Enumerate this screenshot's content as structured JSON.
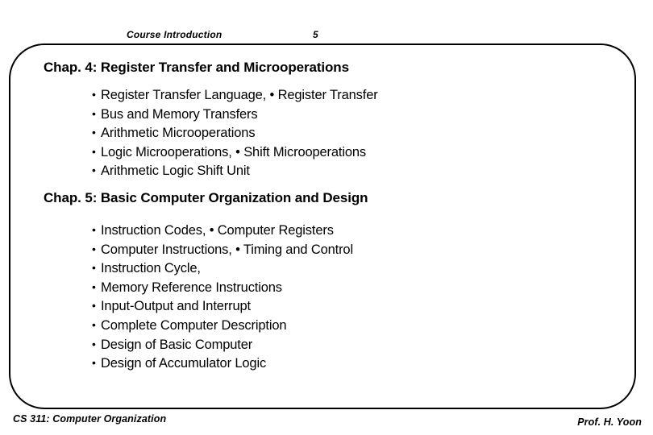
{
  "header": {
    "title": "Course  Introduction",
    "slide_number": "5"
  },
  "frame": {
    "border_color": "#000000",
    "background_color": "#FFFFFF"
  },
  "body": {
    "sections": [
      {
        "heading": "Chap. 4: Register Transfer and Microoperations",
        "bullet_glyph": "•",
        "items": [
          "Register Transfer Language, • Register Transfer",
          "Bus and Memory Transfers",
          "Arithmetic Microoperations",
          "Logic Microoperations, • Shift Microoperations",
          "Arithmetic Logic Shift Unit"
        ]
      },
      {
        "heading": "Chap. 5: Basic Computer Organization and Design",
        "bullet_glyph": "•",
        "items": [
          "Instruction Codes, • Computer Registers",
          "Computer Instructions, • Timing and Control",
          "Instruction Cycle,",
          "Memory Reference Instructions",
          "Input-Output and Interrupt",
          "Complete Computer Description",
          "Design of Basic Computer",
          "Design of Accumulator Logic"
        ]
      }
    ]
  },
  "footer": {
    "course": "CS 311:  Computer Organization",
    "author": "Prof.  H. Yoon"
  }
}
